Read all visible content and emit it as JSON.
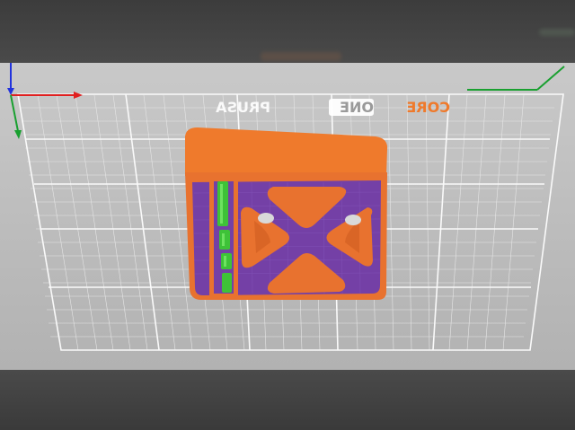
{
  "bed": {
    "logo_left": "PRUSA",
    "logo_mid": "CORE",
    "logo_right": "ONE"
  },
  "colors": {
    "model_orange": "#e8722f",
    "model_purple": "#7440a6",
    "support_green": "#3ec238",
    "axis_x": "#e02020",
    "axis_y": "#19a030",
    "axis_z": "#2233dd",
    "bed_grid": "#f4f4f4"
  },
  "icons": [
    "axis-x-arrow",
    "axis-y-arrow",
    "axis-z-arrow"
  ]
}
